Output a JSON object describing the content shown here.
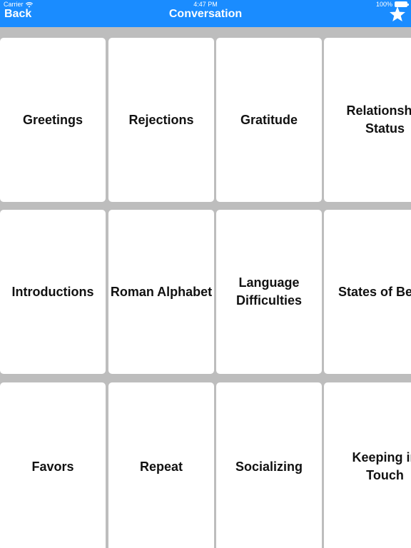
{
  "status_bar": {
    "carrier": "Carrier",
    "time": "4:47 PM",
    "battery": "100%"
  },
  "nav": {
    "back_label": "Back",
    "title": "Conversation",
    "favorites_icon": "star-icon"
  },
  "colors": {
    "accent": "#1a8cff",
    "background": "#bdbdbd",
    "tile": "#ffffff"
  },
  "categories": [
    "Greetings",
    "Rejections",
    "Gratitude",
    "Relationship\nStatus",
    "Introductions",
    "Roman Alphabet",
    "Language\nDifficulties",
    "States of Being",
    "Favors",
    "Repeat",
    "Socializing",
    "Keeping in\nTouch"
  ]
}
